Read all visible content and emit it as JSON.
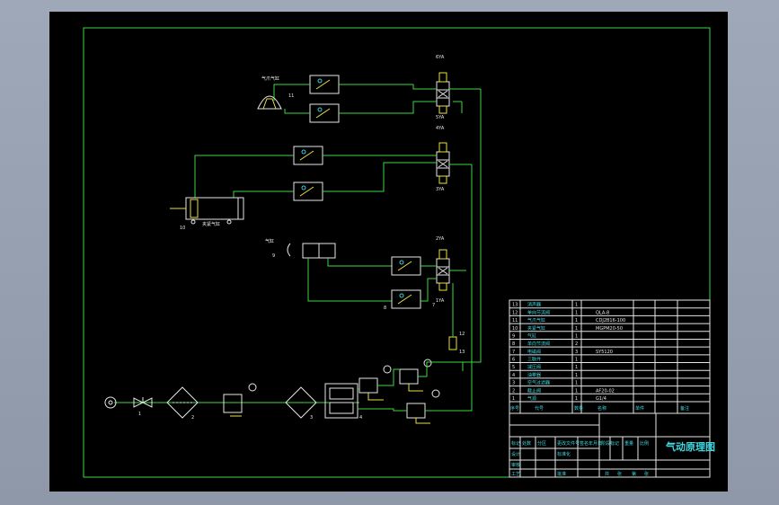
{
  "title_block": {
    "drawing_title": "气动原理图",
    "row_labels": [
      "标记",
      "处数",
      "分区",
      "更改文件号",
      "签名",
      "年月日"
    ],
    "sign_labels": [
      "设计",
      "标准化"
    ],
    "stage_labels": [
      "阶段标记",
      "重量",
      "比例"
    ],
    "bottom_labels": [
      "共",
      "张",
      "第",
      "张"
    ],
    "review_labels": [
      "审核",
      "工艺",
      "批准"
    ],
    "header": [
      "序号",
      "代号",
      "名称",
      "数量",
      "材料",
      "单件",
      "总计",
      "备注"
    ]
  },
  "parts_list": {
    "numbers": [
      "13",
      "12",
      "11",
      "10",
      "9",
      "8",
      "7",
      "6",
      "5",
      "4",
      "3",
      "2",
      "1"
    ],
    "names": [
      "消声器",
      "单向节流阀",
      "气爪气缸",
      "夹紧气缸",
      "气缸",
      "单向节流阀",
      "电磁阀",
      "三联件",
      "减压阀",
      "油雾器",
      "空气过滤器",
      "截止阀",
      "气源"
    ],
    "qty": [
      "1",
      "1",
      "1",
      "1",
      "1",
      "2",
      "3",
      "1",
      "1",
      "1",
      "1",
      "1",
      "1"
    ],
    "codes": [
      "",
      "QLA-8",
      "CDJ2B16-100",
      "MGPM20-50",
      "",
      "",
      "SY5120",
      "",
      "",
      "",
      "",
      "AF20-02",
      "G1/4"
    ]
  },
  "component_labels": {
    "gripper": "气爪气缸",
    "clamp": "夹紧气缸",
    "sensor": "气缸",
    "n11": "11",
    "n10": "10",
    "n9": "9",
    "n8": "8",
    "n7": "7",
    "n12": "12",
    "n13": "13",
    "n1": "1",
    "n2": "2",
    "n3": "3",
    "n4": "4"
  },
  "solenoid_labels": {
    "s6": "6YA",
    "s5": "5YA",
    "s4": "4YA",
    "s3": "3YA",
    "s2": "2YA",
    "s1": "1YA"
  }
}
